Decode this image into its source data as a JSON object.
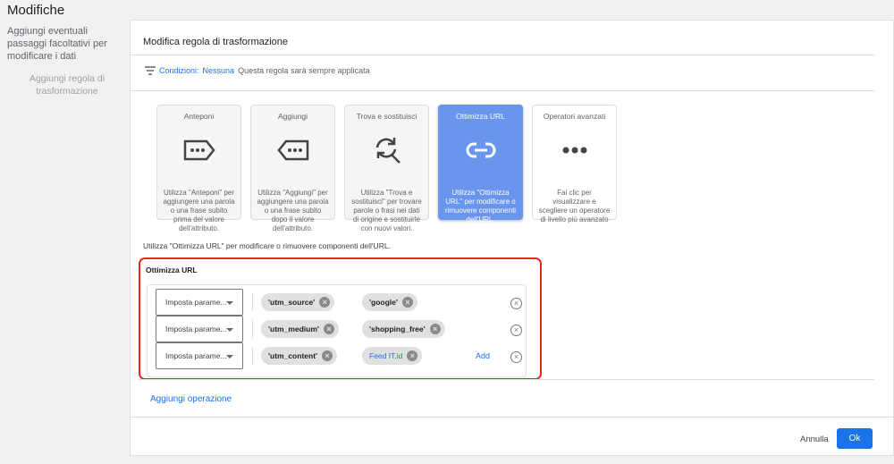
{
  "sidebar": {
    "title": "Modifiche",
    "subtitle": "Aggiungi eventuali passaggi facoltativi per modificare i dati",
    "add_rule": "Aggiungi regola di trasformazione"
  },
  "card": {
    "heading": "Modifica regola di trasformazione",
    "conditions": {
      "label": "Condizioni:",
      "value": "Nessuna",
      "note": "Questa regola sarà sempre applicata"
    },
    "operators": [
      {
        "title": "Anteponi",
        "icon": "prepend-tag-icon",
        "desc": "Utilizza \"Anteponi\" per aggiungere una parola o una frase subito prima del valore dell'attributo."
      },
      {
        "title": "Aggiungi",
        "icon": "append-tag-icon",
        "desc": "Utilizza \"Aggiungi\" per aggiungere una parola o una frase subito dopo il valore dell'attributo."
      },
      {
        "title": "Trova e sostituisci",
        "icon": "find-replace-icon",
        "desc": "Utilizza \"Trova e sostituisci\" per trovare parole o frasi nei dati di origine e sostituirle con nuovi valori."
      },
      {
        "title": "Ottimizza URL",
        "icon": "link-icon",
        "desc": "Utilizza \"Ottimizza URL\" per modificare o rimuovere componenti dell'URL.",
        "selected": true
      },
      {
        "title": "Operatori avanzati",
        "icon": "more-horiz-icon",
        "desc": "Fai clic per visualizzare e scegliere un operatore di livello più avanzato"
      }
    ],
    "info": "Utilizza \"Ottimizza URL\" per modificare o rimuovere componenti dell'URL.",
    "section_label": "Ottimizza URL",
    "rows": [
      {
        "action": "Imposta parame...",
        "key": "'utm_source'",
        "value": "'google'"
      },
      {
        "action": "Imposta parame...",
        "key": "'utm_medium'",
        "value": "'shopping_free'"
      },
      {
        "action": "Imposta parame...",
        "key": "'utm_content'",
        "value_parts": [
          "Feed IT",
          ".id"
        ]
      }
    ],
    "add_label": "Add",
    "add_operation": "Aggiungi operazione",
    "cancel": "Annulla",
    "ok": "Ok"
  },
  "colors": {
    "accent": "#1a73e8",
    "selected_card": "#6a95ee",
    "highlight": "#e8281c",
    "attribute_green": "#1e8e3e"
  }
}
